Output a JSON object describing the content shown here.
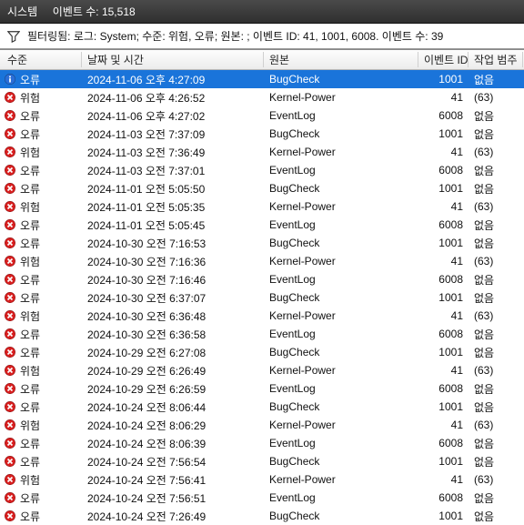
{
  "titlebar": {
    "system_label": "시스템",
    "count_label": "이벤트 수: 15,518"
  },
  "filterbar": {
    "text": "필터링됨: 로그: System; 수준: 위험, 오류; 원본: ; 이벤트 ID: 41, 1001, 6008. 이벤트 수: 39"
  },
  "columns": {
    "level": "수준",
    "date": "날짜 및 시간",
    "source": "원본",
    "id": "이벤트 ID",
    "task": "작업 범주"
  },
  "levels": {
    "error": "오류",
    "critical": "위험"
  },
  "rows": [
    {
      "level": "error",
      "date": "2024-11-06 오후 4:27:09",
      "source": "BugCheck",
      "id": "1001",
      "task": "없음",
      "selected": true,
      "icon": "info"
    },
    {
      "level": "critical",
      "date": "2024-11-06 오후 4:26:52",
      "source": "Kernel-Power",
      "id": "41",
      "task": "(63)"
    },
    {
      "level": "error",
      "date": "2024-11-06 오후 4:27:02",
      "source": "EventLog",
      "id": "6008",
      "task": "없음"
    },
    {
      "level": "error",
      "date": "2024-11-03 오전 7:37:09",
      "source": "BugCheck",
      "id": "1001",
      "task": "없음"
    },
    {
      "level": "critical",
      "date": "2024-11-03 오전 7:36:49",
      "source": "Kernel-Power",
      "id": "41",
      "task": "(63)"
    },
    {
      "level": "error",
      "date": "2024-11-03 오전 7:37:01",
      "source": "EventLog",
      "id": "6008",
      "task": "없음"
    },
    {
      "level": "error",
      "date": "2024-11-01 오전 5:05:50",
      "source": "BugCheck",
      "id": "1001",
      "task": "없음"
    },
    {
      "level": "critical",
      "date": "2024-11-01 오전 5:05:35",
      "source": "Kernel-Power",
      "id": "41",
      "task": "(63)"
    },
    {
      "level": "error",
      "date": "2024-11-01 오전 5:05:45",
      "source": "EventLog",
      "id": "6008",
      "task": "없음"
    },
    {
      "level": "error",
      "date": "2024-10-30 오전 7:16:53",
      "source": "BugCheck",
      "id": "1001",
      "task": "없음"
    },
    {
      "level": "critical",
      "date": "2024-10-30 오전 7:16:36",
      "source": "Kernel-Power",
      "id": "41",
      "task": "(63)"
    },
    {
      "level": "error",
      "date": "2024-10-30 오전 7:16:46",
      "source": "EventLog",
      "id": "6008",
      "task": "없음"
    },
    {
      "level": "error",
      "date": "2024-10-30 오전 6:37:07",
      "source": "BugCheck",
      "id": "1001",
      "task": "없음"
    },
    {
      "level": "critical",
      "date": "2024-10-30 오전 6:36:48",
      "source": "Kernel-Power",
      "id": "41",
      "task": "(63)"
    },
    {
      "level": "error",
      "date": "2024-10-30 오전 6:36:58",
      "source": "EventLog",
      "id": "6008",
      "task": "없음"
    },
    {
      "level": "error",
      "date": "2024-10-29 오전 6:27:08",
      "source": "BugCheck",
      "id": "1001",
      "task": "없음"
    },
    {
      "level": "critical",
      "date": "2024-10-29 오전 6:26:49",
      "source": "Kernel-Power",
      "id": "41",
      "task": "(63)"
    },
    {
      "level": "error",
      "date": "2024-10-29 오전 6:26:59",
      "source": "EventLog",
      "id": "6008",
      "task": "없음"
    },
    {
      "level": "error",
      "date": "2024-10-24 오전 8:06:44",
      "source": "BugCheck",
      "id": "1001",
      "task": "없음"
    },
    {
      "level": "critical",
      "date": "2024-10-24 오전 8:06:29",
      "source": "Kernel-Power",
      "id": "41",
      "task": "(63)"
    },
    {
      "level": "error",
      "date": "2024-10-24 오전 8:06:39",
      "source": "EventLog",
      "id": "6008",
      "task": "없음"
    },
    {
      "level": "error",
      "date": "2024-10-24 오전 7:56:54",
      "source": "BugCheck",
      "id": "1001",
      "task": "없음"
    },
    {
      "level": "critical",
      "date": "2024-10-24 오전 7:56:41",
      "source": "Kernel-Power",
      "id": "41",
      "task": "(63)"
    },
    {
      "level": "error",
      "date": "2024-10-24 오전 7:56:51",
      "source": "EventLog",
      "id": "6008",
      "task": "없음"
    },
    {
      "level": "error",
      "date": "2024-10-24 오전 7:26:49",
      "source": "BugCheck",
      "id": "1001",
      "task": "없음"
    }
  ]
}
